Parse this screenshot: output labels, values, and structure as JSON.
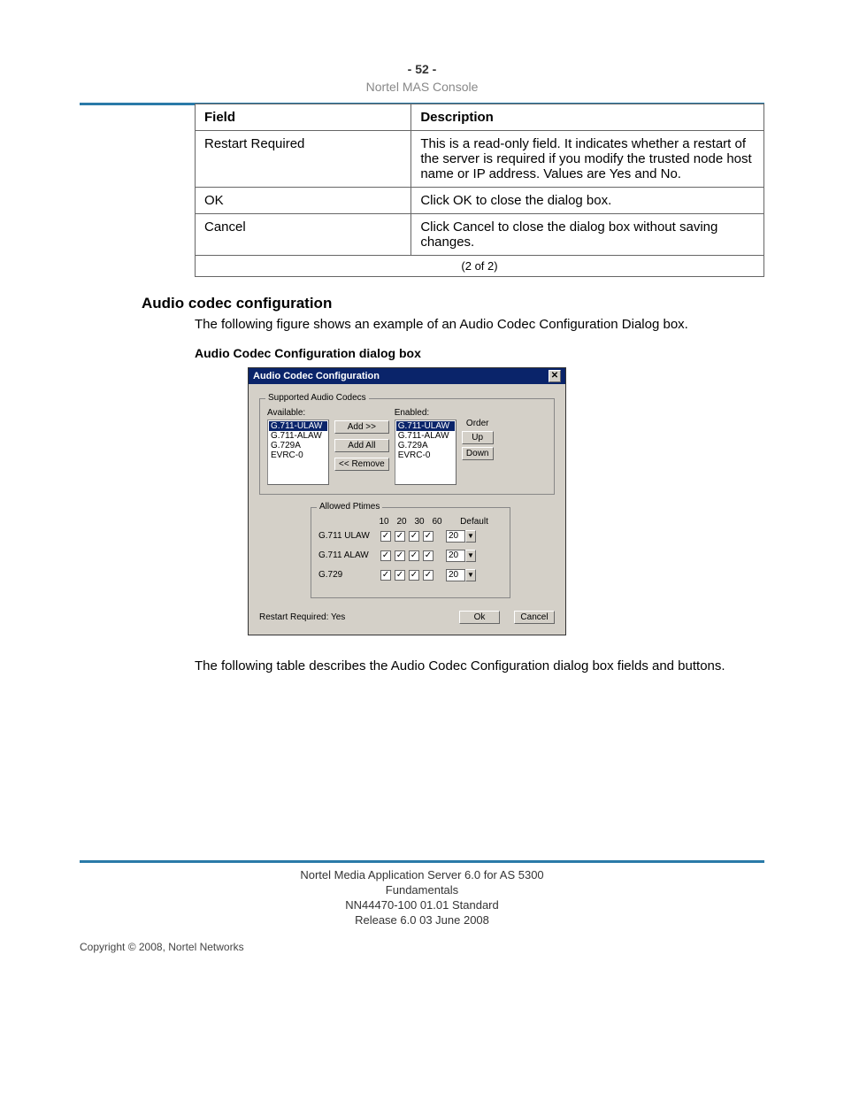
{
  "header": {
    "page_number": "- 52 -",
    "title": "Nortel MAS Console"
  },
  "table": {
    "col_field": "Field",
    "col_desc": "Description",
    "rows": [
      {
        "field": "Restart Required",
        "desc": "This is a read-only field. It indicates whether a restart of the server is required if you modify the trusted node host name or IP address. Values are Yes and No."
      },
      {
        "field": "OK",
        "desc": "Click OK to close the dialog box."
      },
      {
        "field": "Cancel",
        "desc": "Click Cancel to close the dialog box without saving changes."
      }
    ],
    "pager": "(2 of 2)"
  },
  "section": {
    "heading": "Audio codec configuration",
    "intro": "The following figure shows an example of an Audio Codec Configuration Dialog box.",
    "figure_caption": "Audio Codec Configuration dialog box",
    "outro": "The following table describes the Audio Codec Configuration dialog box fields and buttons."
  },
  "dialog": {
    "title": "Audio Codec Configuration",
    "group_codecs": "Supported Audio Codecs",
    "label_available": "Available:",
    "label_enabled": "Enabled:",
    "codec_list": [
      "G.711-ULAW",
      "G.711-ALAW",
      "G.729A",
      "EVRC-0"
    ],
    "btn_add": "Add >>",
    "btn_addall": "Add All",
    "btn_remove": "<< Remove",
    "order_label": "Order",
    "btn_up": "Up",
    "btn_down": "Down",
    "group_ptimes": "Allowed Ptimes",
    "pt_cols": [
      "10",
      "20",
      "30",
      "60"
    ],
    "pt_default": "Default",
    "pt_rows": [
      {
        "name": "G.711 ULAW",
        "def": "20"
      },
      {
        "name": "G.711 ALAW",
        "def": "20"
      },
      {
        "name": "G.729",
        "def": "20"
      }
    ],
    "restart": "Restart Required:   Yes",
    "btn_ok": "Ok",
    "btn_cancel": "Cancel"
  },
  "footer": {
    "line1": "Nortel Media Application Server 6.0 for AS 5300",
    "line2": "Fundamentals",
    "line3": "NN44470-100   01.01   Standard",
    "line4": "Release 6.0   03 June 2008",
    "copyright": "Copyright © 2008, Nortel Networks"
  }
}
